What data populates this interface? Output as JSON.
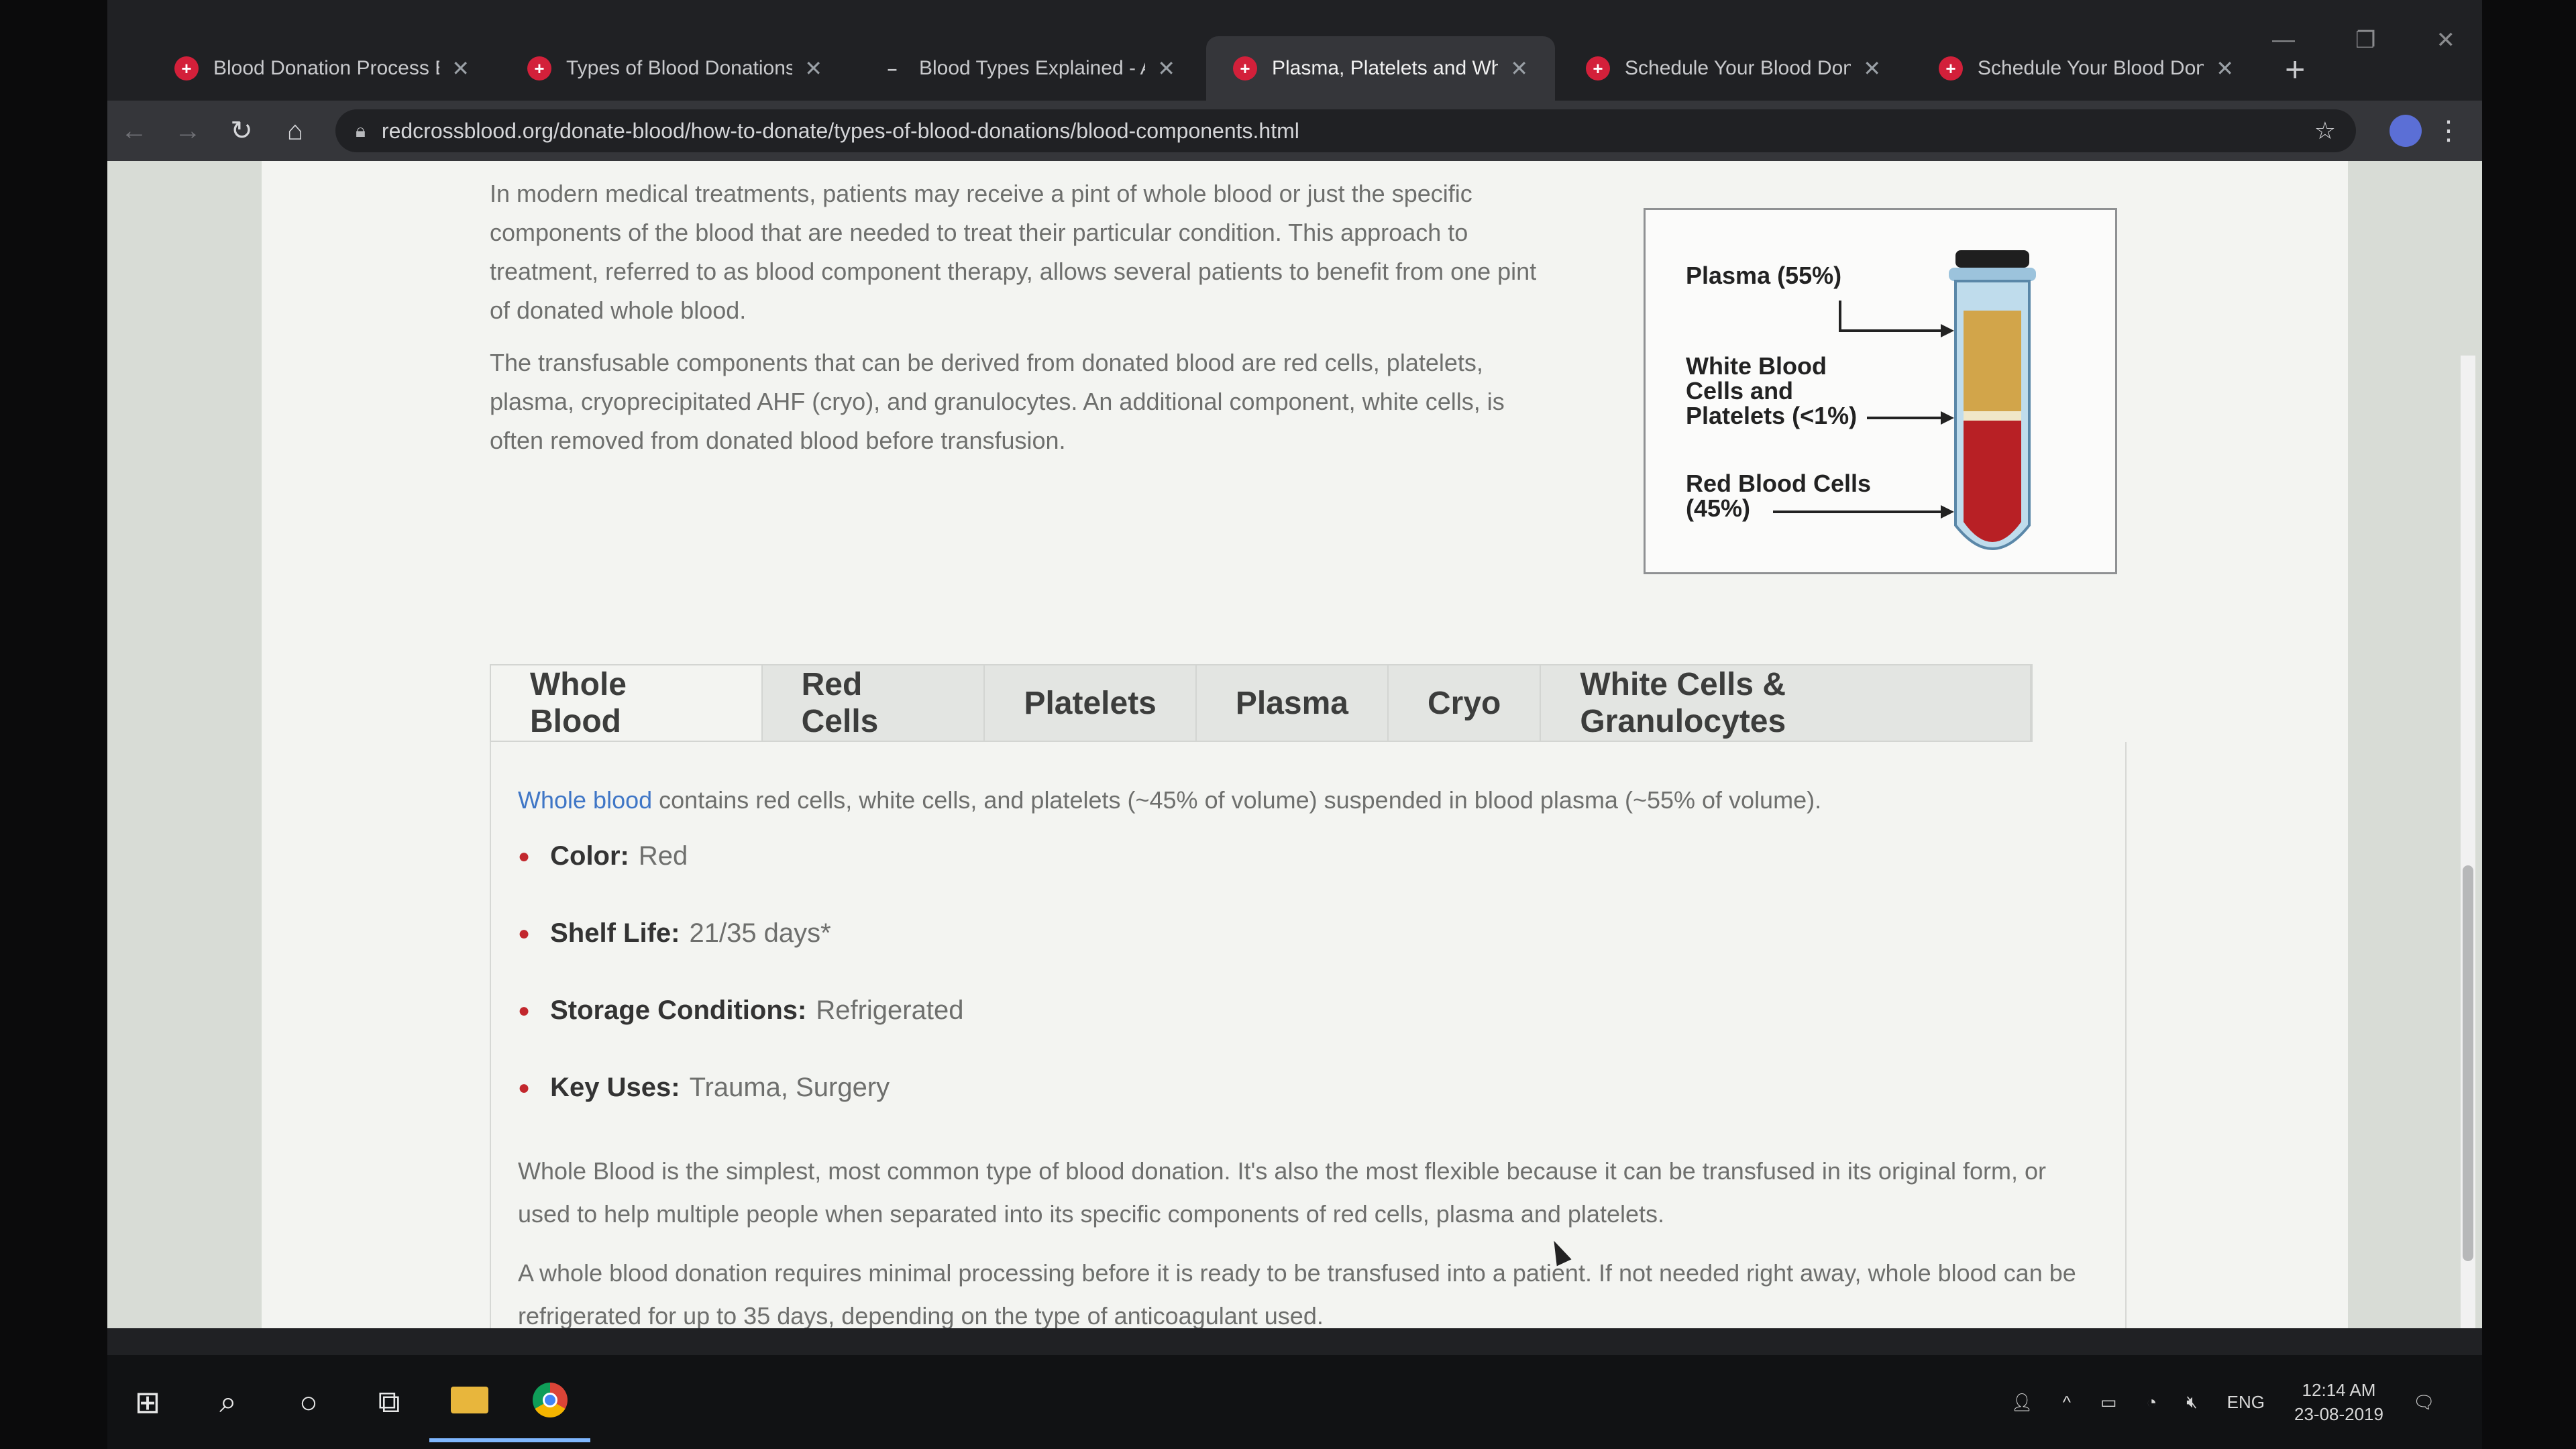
{
  "tabs": [
    {
      "title": "Blood Donation Process Exp",
      "favicon": "red-cross-icon",
      "active": false
    },
    {
      "title": "Types of Blood Donations Ex",
      "favicon": "red-cross-icon",
      "active": false
    },
    {
      "title": "Blood Types Explained - A, B",
      "favicon": "dash-icon",
      "active": false
    },
    {
      "title": "Plasma, Platelets and Whole",
      "favicon": "red-cross-icon",
      "active": true
    },
    {
      "title": "Schedule Your Blood Donati",
      "favicon": "red-cross-icon",
      "active": false
    },
    {
      "title": "Schedule Your Blood Donati",
      "favicon": "red-cross-icon",
      "active": false
    }
  ],
  "address_bar": {
    "url": "redcrossblood.org/donate-blood/how-to-donate/types-of-blood-donations/blood-components.html"
  },
  "intro": {
    "p1": "In modern medical treatments, patients may receive a pint of whole blood or just the specific components of the blood that are needed to treat their particular condition. This approach to treatment, referred to as blood component therapy, allows several patients to benefit from one pint of donated whole blood.",
    "p2": "The transfusable components that can be derived from donated blood are red cells, platelets, plasma, cryoprecipitated AHF (cryo), and granulocytes. An additional component, white cells, is often removed from donated blood before transfusion."
  },
  "figure": {
    "plasma_label": "Plasma (55%)",
    "wbc_line1": "White Blood",
    "wbc_line2": "Cells and",
    "wbc_line3": "Platelets (<1%)",
    "rbc_line1": "Red Blood Cells",
    "rbc_line2": "(45%)",
    "plasma_color": "#d2a54a",
    "rbc_color": "#b82025"
  },
  "component_tabs": [
    "Whole Blood",
    "Red Cells",
    "Platelets",
    "Plasma",
    "Cryo",
    "White Cells & Granulocytes"
  ],
  "panel": {
    "lead_link": "Whole blood",
    "lead_rest": " contains red cells, white cells, and platelets (~45% of volume) suspended in blood plasma (~55% of volume).",
    "items": [
      {
        "label": "Color:",
        "value": "Red"
      },
      {
        "label": "Shelf Life:",
        "value": "21/35 days*"
      },
      {
        "label": "Storage Conditions:",
        "value": "Refrigerated"
      },
      {
        "label": "Key Uses:",
        "value": "Trauma, Surgery"
      }
    ],
    "para1": "Whole Blood is the simplest, most common type of blood donation. It's also the most flexible because it can be transfused in its original form, or used to help multiple people when separated into its specific components of red cells, plasma and platelets.",
    "para2": "A whole blood donation requires minimal processing before it is ready to be transfused into a patient. If not needed right away, whole blood can be refrigerated for up to 35 days, depending on the type of anticoagulant used."
  },
  "tray": {
    "lang": "ENG",
    "time": "12:14 AM",
    "date": "23-08-2019"
  }
}
